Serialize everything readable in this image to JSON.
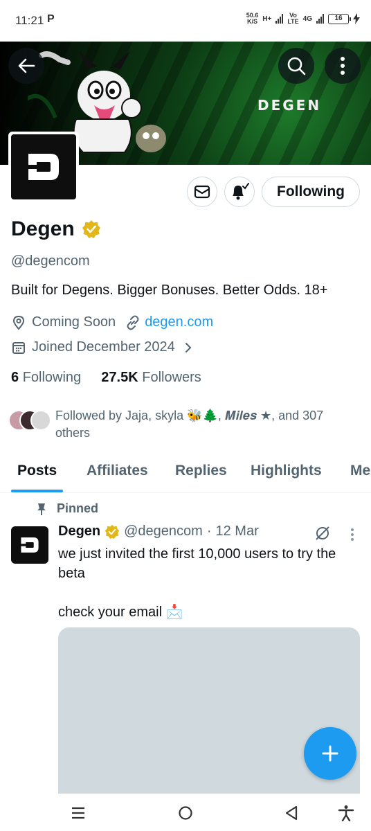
{
  "status_bar": {
    "time": "11:21",
    "carrier_icon": "P",
    "speed_value": "50.6",
    "speed_unit": "K/S",
    "network_1": "H+",
    "network_2_top": "Vo",
    "network_2_bottom": "LTE",
    "network_3": "4G",
    "battery_level": "16"
  },
  "banner": {
    "brand_text": "DEGEN",
    "back_icon": "arrow-left-icon",
    "search_icon": "search-icon",
    "more_icon": "more-vertical-icon"
  },
  "profile": {
    "name": "Degen",
    "verified_icon": "verified-badge-icon",
    "handle": "@degencom",
    "bio": "Built for Degens. Bigger Bonuses. Better Odds. 18+",
    "location": "Coming Soon",
    "website": "degen.com",
    "joined": "Joined December 2024",
    "following_count": "6",
    "following_label": "Following",
    "followers_count": "27.5K",
    "followers_label": "Followers",
    "followed_by": "Followed by Jaja, skyla 🐝🌲, 𝑴𝒊𝒍𝒆𝒔 ★, and 307 others",
    "follow_button_label": "Following"
  },
  "tabs": [
    "Posts",
    "Affiliates",
    "Replies",
    "Highlights",
    "Me"
  ],
  "active_tab": "Posts",
  "post": {
    "pinned_label": "Pinned",
    "author_name": "Degen",
    "author_handle": "@degencom",
    "separator": "·",
    "date": "12 Mar",
    "text_line_1": "we just invited the first 10,000 users to try the beta",
    "text_line_2": "check your email 📩"
  },
  "colors": {
    "accent": "#1d9bf0",
    "text_primary": "#0f1419",
    "text_secondary": "#536471",
    "verified_gold": "#e2b719"
  }
}
